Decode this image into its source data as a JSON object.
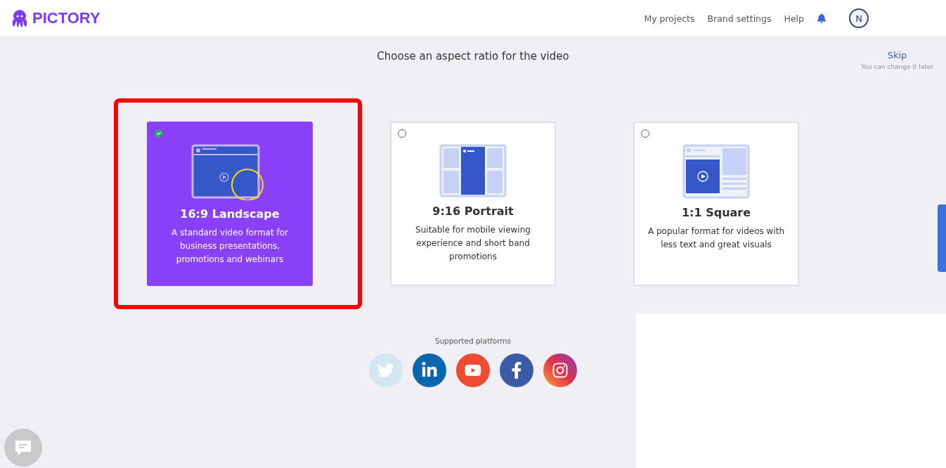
{
  "header": {
    "brand": "PICTORY",
    "nav": [
      "My projects",
      "Brand settings",
      "Help"
    ],
    "avatar": "N"
  },
  "title": "Choose an aspect ratio for the video",
  "skip": {
    "label": "Skip",
    "hint": "You can change it later"
  },
  "options": [
    {
      "kind": "landscape",
      "title": "16:9 Landscape",
      "description": "A standard video format for business presentations, promotions and webinars",
      "selected": true
    },
    {
      "kind": "portrait",
      "title": "9:16 Portrait",
      "description": "Suitable for mobile viewing experience and short band promotions",
      "selected": false
    },
    {
      "kind": "square",
      "title": "1:1 Square",
      "description": "A popular format for videos with less text and great visuals",
      "selected": false
    }
  ],
  "platforms": {
    "label": "Supported platforms",
    "items": [
      {
        "kind": "twitter"
      },
      {
        "kind": "linkedin"
      },
      {
        "kind": "youtube"
      },
      {
        "kind": "facebook"
      },
      {
        "kind": "instagram"
      }
    ]
  }
}
